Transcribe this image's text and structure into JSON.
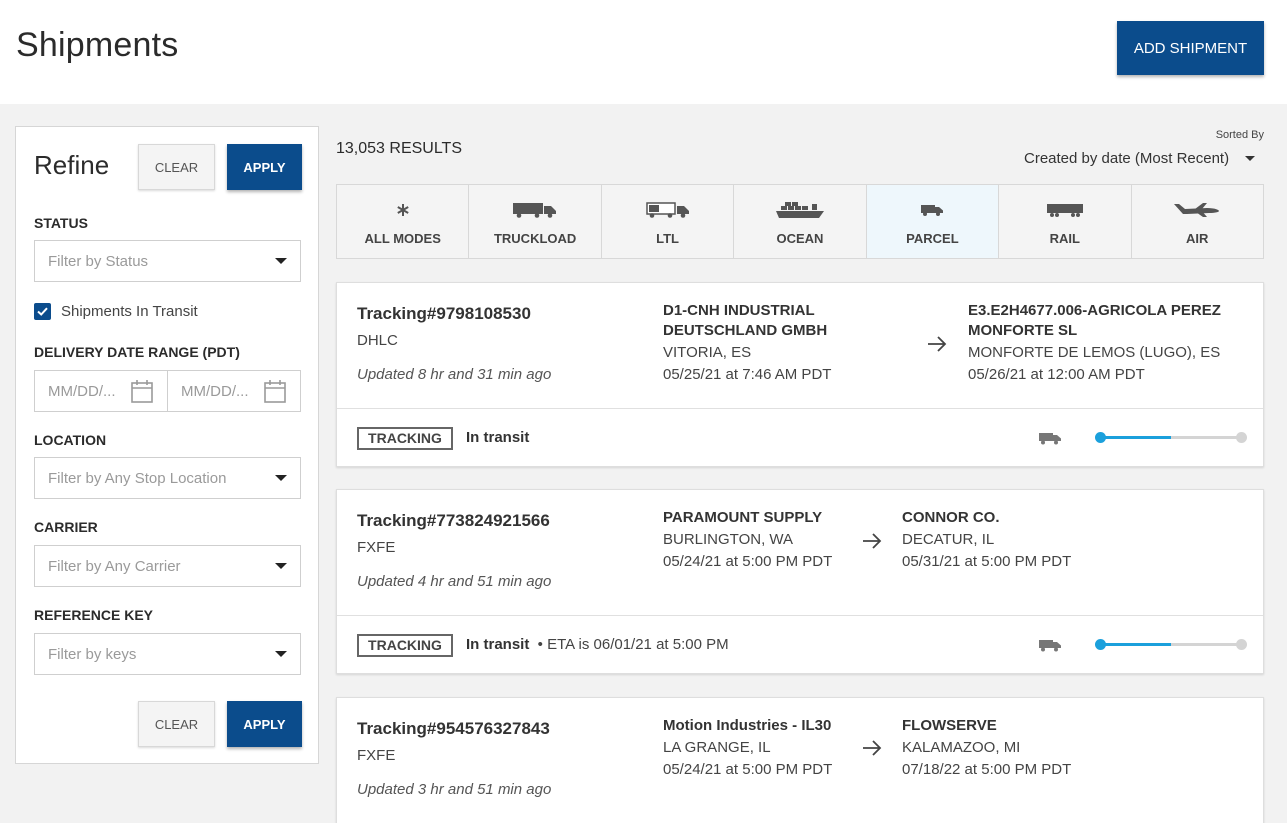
{
  "header": {
    "title": "Shipments",
    "add_button": "ADD SHIPMENT"
  },
  "refine": {
    "title": "Refine",
    "clear_label": "CLEAR",
    "apply_label": "APPLY",
    "status_label": "STATUS",
    "status_placeholder": "Filter by Status",
    "in_transit_label": "Shipments In Transit",
    "in_transit_checked": true,
    "date_range_label": "DELIVERY DATE RANGE (PDT)",
    "date_from_placeholder": "MM/DD/...",
    "date_to_placeholder": "MM/DD/...",
    "location_label": "LOCATION",
    "location_placeholder": "Filter by Any Stop Location",
    "carrier_label": "CARRIER",
    "carrier_placeholder": "Filter by Any Carrier",
    "reference_label": "REFERENCE KEY",
    "reference_placeholder": "Filter by keys"
  },
  "results": {
    "count": "13,053 RESULTS",
    "sorted_by_label": "Sorted By",
    "sort_value": "Created by date (Most Recent)"
  },
  "modes": [
    {
      "label": "ALL MODES",
      "icon": "asterisk-icon"
    },
    {
      "label": "TRUCKLOAD",
      "icon": "truckload-icon"
    },
    {
      "label": "LTL",
      "icon": "ltl-truck-icon"
    },
    {
      "label": "OCEAN",
      "icon": "ship-icon"
    },
    {
      "label": "PARCEL",
      "icon": "parcel-van-icon",
      "active": true
    },
    {
      "label": "RAIL",
      "icon": "rail-icon"
    },
    {
      "label": "AIR",
      "icon": "plane-icon"
    }
  ],
  "shipments": [
    {
      "tracking": "Tracking#9798108530",
      "carrier": "DHLC",
      "updated": "Updated 8 hr and 31 min ago",
      "origin_name_1": "D1-CNH INDUSTRIAL",
      "origin_name_2": "DEUTSCHLAND GMBH",
      "origin_city": "VITORIA, ES",
      "origin_date": "05/25/21 at 7:46 AM PDT",
      "dest_name_1": "E3.E2H4677.006-AGRICOLA PEREZ",
      "dest_name_2": "MONFORTE SL",
      "dest_city": "MONFORTE DE LEMOS (LUGO), ES",
      "dest_date": "05/26/21 at 12:00 AM PDT",
      "badge": "TRACKING",
      "status": "In transit",
      "eta": "",
      "progress": 0.5
    },
    {
      "tracking": "Tracking#773824921566",
      "carrier": "FXFE",
      "updated": "Updated 4 hr and 51 min ago",
      "origin_name_1": "PARAMOUNT SUPPLY",
      "origin_city": "BURLINGTON, WA",
      "origin_date": "05/24/21 at 5:00 PM PDT",
      "dest_name_1": "CONNOR CO.",
      "dest_city": "DECATUR, IL",
      "dest_date": "05/31/21 at 5:00 PM PDT",
      "badge": "TRACKING",
      "status": "In transit",
      "eta": "ETA is 06/01/21 at 5:00 PM",
      "progress": 0.5
    },
    {
      "tracking": "Tracking#954576327843",
      "carrier": "FXFE",
      "updated": "Updated 3 hr and 51 min ago",
      "origin_name_1": "Motion Industries - IL30",
      "origin_city": "LA GRANGE, IL",
      "origin_date": "05/24/21 at 5:00 PM PDT",
      "dest_name_1": "FLOWSERVE",
      "dest_city": "KALAMAZOO, MI",
      "dest_date": "07/18/22 at 5:00 PM PDT"
    }
  ],
  "colors": {
    "primary": "#0b4c8c",
    "progress": "#1ba0dc",
    "active_mode_bg": "#eef7fc"
  }
}
